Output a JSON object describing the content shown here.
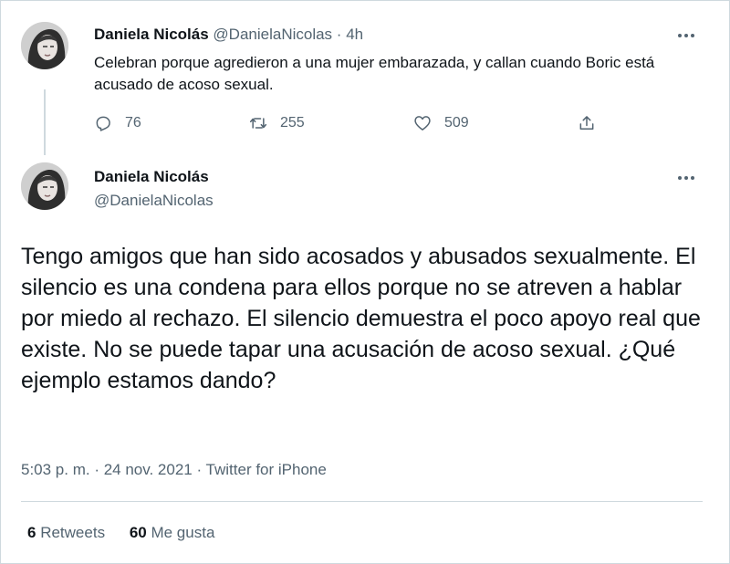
{
  "reply_tweet": {
    "name": "Daniela Nicolás",
    "handle": "@DanielaNicolas",
    "separator": "·",
    "time": "4h",
    "text": "Celebran porque agredieron a una mujer embarazada, y callan cuando Boric está acusado de acoso sexual.",
    "actions": {
      "replies": "76",
      "retweets": "255",
      "likes": "509"
    }
  },
  "main_tweet": {
    "name": "Daniela Nicolás",
    "handle": "@DanielaNicolas",
    "text": "Tengo amigos que han sido acosados y abusados sexualmente. El silencio es una condena para ellos porque no se atreven a hablar por miedo al rechazo. El silencio demuestra el poco apoyo real que existe. No se puede tapar una acusación de acoso sexual. ¿Qué ejemplo estamos dando?",
    "meta": "5:03 p. m. · 24 nov. 2021 · Twitter for iPhone",
    "retweets_count": "6",
    "retweets_label": "Retweets",
    "likes_count": "60",
    "likes_label": "Me gusta"
  },
  "icons": [
    "avatar",
    "more-icon",
    "reply-icon",
    "retweet-icon",
    "like-icon",
    "share-icon"
  ],
  "colors": {
    "text": "#0f1419",
    "muted": "#536471",
    "border": "#cfd9de",
    "background": "#ffffff"
  }
}
